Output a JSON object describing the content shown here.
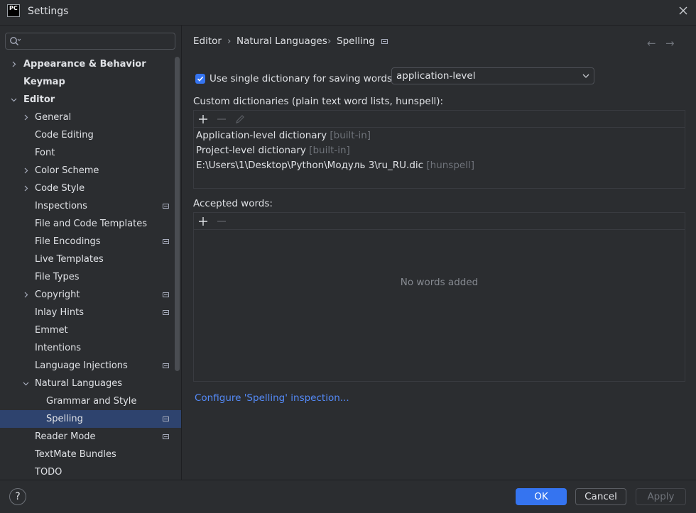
{
  "window": {
    "title": "Settings",
    "logo_text": "PC"
  },
  "search": {
    "placeholder": ""
  },
  "sidebar": {
    "items": [
      {
        "label": "Appearance & Behavior",
        "bold": true,
        "expander": "collapsed",
        "indent": 0
      },
      {
        "label": "Keymap",
        "bold": true,
        "expander": "none",
        "indent": 0
      },
      {
        "label": "Editor",
        "bold": true,
        "expander": "expanded",
        "indent": 0
      },
      {
        "label": "General",
        "bold": false,
        "expander": "collapsed",
        "indent": 1
      },
      {
        "label": "Code Editing",
        "bold": false,
        "expander": "none",
        "indent": 1
      },
      {
        "label": "Font",
        "bold": false,
        "expander": "none",
        "indent": 1
      },
      {
        "label": "Color Scheme",
        "bold": false,
        "expander": "collapsed",
        "indent": 1
      },
      {
        "label": "Code Style",
        "bold": false,
        "expander": "collapsed",
        "indent": 1
      },
      {
        "label": "Inspections",
        "bold": false,
        "expander": "none",
        "indent": 1,
        "project_icon": true
      },
      {
        "label": "File and Code Templates",
        "bold": false,
        "expander": "none",
        "indent": 1
      },
      {
        "label": "File Encodings",
        "bold": false,
        "expander": "none",
        "indent": 1,
        "project_icon": true
      },
      {
        "label": "Live Templates",
        "bold": false,
        "expander": "none",
        "indent": 1
      },
      {
        "label": "File Types",
        "bold": false,
        "expander": "none",
        "indent": 1
      },
      {
        "label": "Copyright",
        "bold": false,
        "expander": "collapsed",
        "indent": 1,
        "project_icon": true
      },
      {
        "label": "Inlay Hints",
        "bold": false,
        "expander": "none",
        "indent": 1,
        "project_icon": true
      },
      {
        "label": "Emmet",
        "bold": false,
        "expander": "none",
        "indent": 1
      },
      {
        "label": "Intentions",
        "bold": false,
        "expander": "none",
        "indent": 1
      },
      {
        "label": "Language Injections",
        "bold": false,
        "expander": "none",
        "indent": 1,
        "project_icon": true
      },
      {
        "label": "Natural Languages",
        "bold": false,
        "expander": "expanded",
        "indent": 1
      },
      {
        "label": "Grammar and Style",
        "bold": false,
        "expander": "none",
        "indent": 2
      },
      {
        "label": "Spelling",
        "bold": false,
        "expander": "none",
        "indent": 2,
        "project_icon": true,
        "selected": true
      },
      {
        "label": "Reader Mode",
        "bold": false,
        "expander": "none",
        "indent": 1,
        "project_icon": true
      },
      {
        "label": "TextMate Bundles",
        "bold": false,
        "expander": "none",
        "indent": 1
      },
      {
        "label": "TODO",
        "bold": false,
        "expander": "none",
        "indent": 1
      }
    ]
  },
  "breadcrumb": {
    "items": [
      "Editor",
      "Natural Languages",
      "Spelling"
    ],
    "separator": "›"
  },
  "nav": {
    "back": "←",
    "forward": "→"
  },
  "single_dictionary": {
    "checked": true,
    "label": "Use single dictionary for saving words:",
    "selected_value": "application-level"
  },
  "custom_dictionaries": {
    "label": "Custom dictionaries (plain text word lists, hunspell):",
    "rows": [
      {
        "name": "Application-level dictionary",
        "tag": "[built-in]"
      },
      {
        "name": "Project-level dictionary",
        "tag": "[built-in]"
      },
      {
        "name": "E:\\Users\\1\\Desktop\\Python\\Модуль 3\\ru_RU.dic",
        "tag": "[hunspell]"
      }
    ]
  },
  "accepted_words": {
    "label": "Accepted words:",
    "empty_text": "No words added"
  },
  "configure_link": "Configure 'Spelling' inspection...",
  "buttons": {
    "help": "?",
    "ok": "OK",
    "cancel": "Cancel",
    "apply": "Apply"
  },
  "colors": {
    "accent": "#3574f0",
    "selection": "#2e436e",
    "link": "#548af7",
    "background": "#2b2d30"
  }
}
